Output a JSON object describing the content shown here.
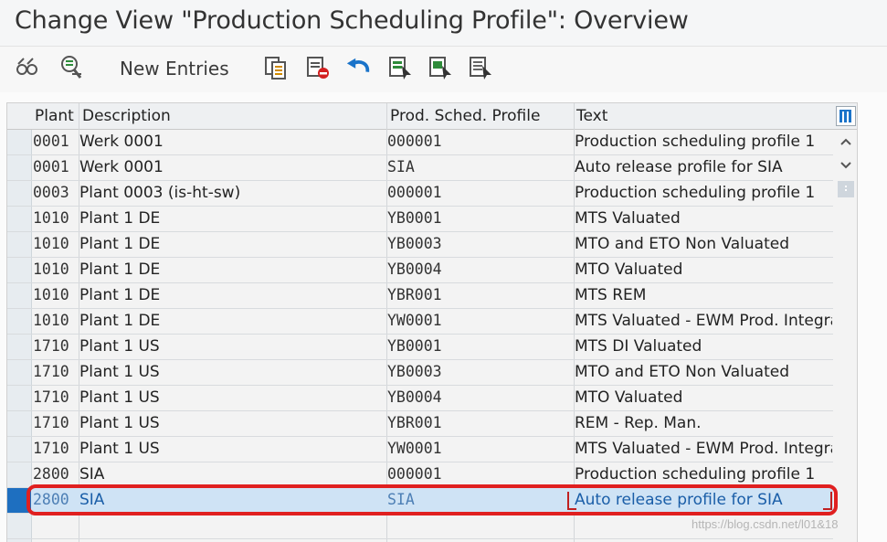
{
  "window": {
    "title": "Change View \"Production Scheduling Profile\": Overview"
  },
  "toolbar": {
    "icons": [
      "display-change-icon",
      "select-icon",
      "copy-as-icon",
      "delete-icon",
      "undo-icon",
      "select-all-icon",
      "select-block-icon",
      "deselect-all-icon"
    ],
    "new_entries_label": "New Entries"
  },
  "table": {
    "columns": [
      "Plant",
      "Description",
      "Prod. Sched. Profile",
      "Text"
    ],
    "rows": [
      {
        "plant": "0001",
        "description": "Werk 0001",
        "profile": "000001",
        "text": "Production scheduling profile 1"
      },
      {
        "plant": "0001",
        "description": "Werk 0001",
        "profile": "SIA",
        "text": "Auto release profile for SIA"
      },
      {
        "plant": "0003",
        "description": "Plant 0003 (is-ht-sw)",
        "profile": "000001",
        "text": "Production scheduling profile 1"
      },
      {
        "plant": "1010",
        "description": "Plant 1 DE",
        "profile": "YB0001",
        "text": "MTS Valuated"
      },
      {
        "plant": "1010",
        "description": "Plant 1 DE",
        "profile": "YB0003",
        "text": "MTO and ETO Non Valuated"
      },
      {
        "plant": "1010",
        "description": "Plant 1 DE",
        "profile": "YB0004",
        "text": "MTO Valuated"
      },
      {
        "plant": "1010",
        "description": "Plant 1 DE",
        "profile": "YBR001",
        "text": "MTS REM"
      },
      {
        "plant": "1010",
        "description": "Plant 1 DE",
        "profile": "YW0001",
        "text": "MTS Valuated - EWM Prod. Integrat"
      },
      {
        "plant": "1710",
        "description": "Plant 1 US",
        "profile": "YB0001",
        "text": "MTS DI Valuated"
      },
      {
        "plant": "1710",
        "description": "Plant 1 US",
        "profile": "YB0003",
        "text": "MTO and ETO Non Valuated"
      },
      {
        "plant": "1710",
        "description": "Plant 1 US",
        "profile": "YB0004",
        "text": "MTO Valuated"
      },
      {
        "plant": "1710",
        "description": "Plant 1 US",
        "profile": "YBR001",
        "text": "REM - Rep. Man."
      },
      {
        "plant": "1710",
        "description": "Plant 1 US",
        "profile": "YW0001",
        "text": "MTS Valuated - EWM Prod. Integrat"
      },
      {
        "plant": "2800",
        "description": "SIA",
        "profile": "000001",
        "text": "Production scheduling profile 1"
      },
      {
        "plant": "2800",
        "description": "SIA",
        "profile": "SIA",
        "text": "Auto release profile for SIA",
        "selected": true
      }
    ]
  },
  "watermark": "https://blog.csdn.net/l01&18",
  "colors": {
    "selected_row": "#cfe3f5",
    "selected_marker": "#1e6fc0",
    "highlight_box": "#e02020",
    "accent": "#1a5ea8"
  }
}
